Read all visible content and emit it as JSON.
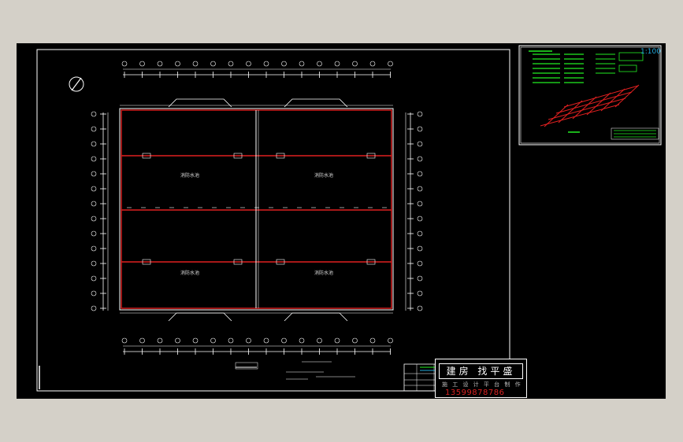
{
  "drawing": {
    "scale_label": "1:100",
    "rooms": [
      "消防水池",
      "消防水池",
      "消防水池",
      "消防水池"
    ]
  },
  "watermark": {
    "title": "建房 找平盛",
    "subtitle": "施 工 设 计 平 台 制 作",
    "phone": "13599878786"
  },
  "colors": {
    "background": "#000000",
    "outer_frame": "#d4d0c8",
    "wall_red": "#e02020",
    "legend_green": "#22ee22",
    "line_white": "#ffffff",
    "title_yellow": "#f0e020"
  }
}
